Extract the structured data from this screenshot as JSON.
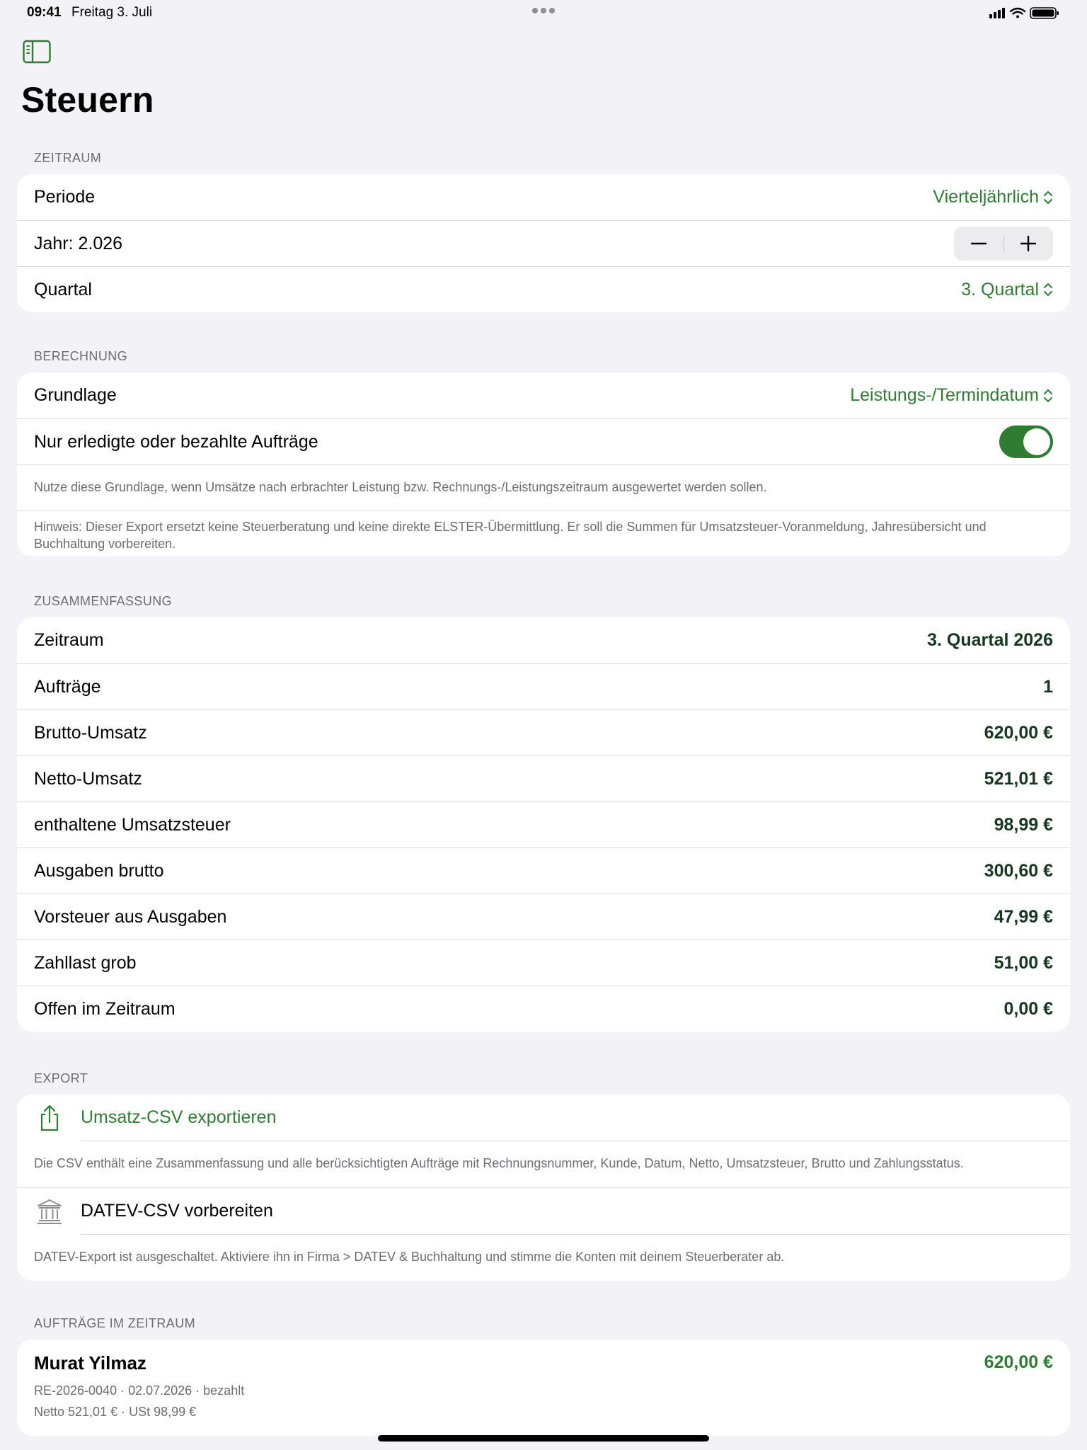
{
  "status_bar": {
    "time": "09:41",
    "date": "Freitag 3. Juli"
  },
  "page_title": "Steuern",
  "zeitraum": {
    "header": "Zeitraum",
    "periode_label": "Periode",
    "periode_value": "Vierteljährlich",
    "jahr_label": "Jahr: 2.026",
    "quartal_label": "Quartal",
    "quartal_value": "3. Quartal"
  },
  "berechnung": {
    "header": "Berechnung",
    "grundlage_label": "Grundlage",
    "grundlage_value": "Leistungs-/Termindatum",
    "toggle_label": "Nur erledigte oder bezahlte Aufträge",
    "toggle_on": true,
    "note_1": "Nutze diese Grundlage, wenn Umsätze nach erbrachter Leistung bzw. Rechnungs-/Leistungszeitraum ausgewertet werden sollen.",
    "note_2": "Hinweis: Dieser Export ersetzt keine Steuerberatung und keine direkte ELSTER-Übermittlung. Er soll die Summen für Umsatzsteuer-Voranmeldung, Jahresübersicht und Buchhaltung vorbereiten."
  },
  "zusammenfassung": {
    "header": "Zusammenfassung",
    "rows": [
      {
        "label": "Zeitraum",
        "value": "3. Quartal 2026"
      },
      {
        "label": "Aufträge",
        "value": "1"
      },
      {
        "label": "Brutto-Umsatz",
        "value": "620,00 €"
      },
      {
        "label": "Netto-Umsatz",
        "value": "521,01 €"
      },
      {
        "label": "enthaltene Umsatzsteuer",
        "value": "98,99 €"
      },
      {
        "label": "Ausgaben brutto",
        "value": "300,60 €"
      },
      {
        "label": "Vorsteuer aus Ausgaben",
        "value": "47,99 €"
      },
      {
        "label": "Zahllast grob",
        "value": "51,00 €"
      },
      {
        "label": "Offen im Zeitraum",
        "value": "0,00 €"
      }
    ]
  },
  "export": {
    "header": "Export",
    "csv_label": "Umsatz-CSV exportieren",
    "csv_note": "Die CSV enthält eine Zusammenfassung und alle berücksichtigten Aufträge mit Rechnungsnummer, Kunde, Datum, Netto, Umsatzsteuer, Brutto und Zahlungsstatus.",
    "datev_label": "DATEV-CSV vorbereiten",
    "datev_note": "DATEV-Export ist ausgeschaltet. Aktiviere ihn in Firma > DATEV & Buchhaltung und stimme die Konten mit deinem Steuerberater ab."
  },
  "auftraege": {
    "header": "Aufträge im Zeitraum",
    "items": [
      {
        "name": "Murat Yilmaz",
        "amount": "620,00 €",
        "meta": "RE-2026-0040 · 02.07.2026 · bezahlt",
        "meta2": "Netto 521,01 € · USt 98,99 €"
      }
    ]
  },
  "colors": {
    "accent": "#2e7d32",
    "background": "#f2f2f7",
    "secondary_text": "#6d6d72"
  }
}
